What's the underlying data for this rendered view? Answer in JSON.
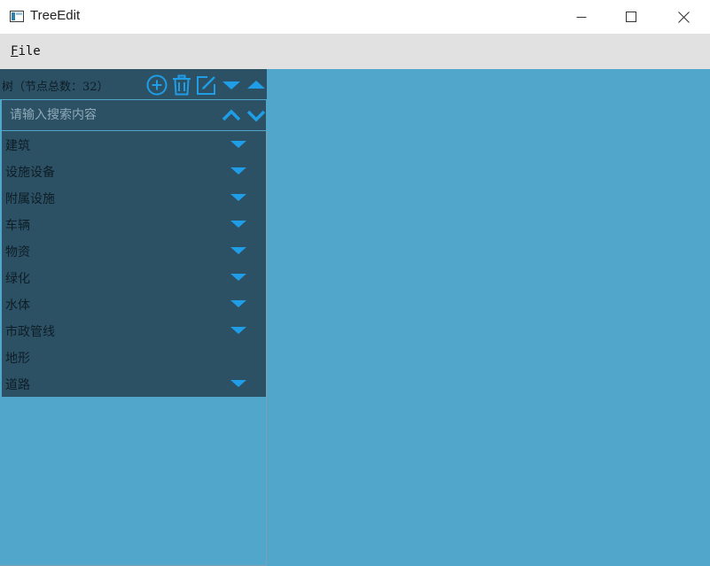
{
  "window": {
    "title": "TreeEdit"
  },
  "menubar": {
    "file_label": "File",
    "file_mnemonic": "F",
    "file_rest": "ile"
  },
  "tree": {
    "header_title": "树（节点总数：32）",
    "search_placeholder": "请输入搜索内容",
    "search_value": "",
    "header_icons": [
      "add-circle-icon",
      "trash-icon",
      "edit-icon",
      "collapse-down-icon",
      "expand-up-icon"
    ],
    "nav_icons": [
      "search-prev-icon",
      "search-next-icon"
    ],
    "items": [
      {
        "label": "建筑",
        "expandable": true
      },
      {
        "label": "设施设备",
        "expandable": true
      },
      {
        "label": "附属设施",
        "expandable": true
      },
      {
        "label": "车辆",
        "expandable": true
      },
      {
        "label": "物资",
        "expandable": true
      },
      {
        "label": "绿化",
        "expandable": true
      },
      {
        "label": "水体",
        "expandable": true
      },
      {
        "label": "市政管线",
        "expandable": true
      },
      {
        "label": "地形",
        "expandable": false
      },
      {
        "label": "道路",
        "expandable": true
      }
    ]
  },
  "colors": {
    "accent": "#1f9de6",
    "panel_bg": "#2c5165",
    "workspace_bg": "#51a7cb",
    "menubar_bg": "#e1e1e1"
  }
}
